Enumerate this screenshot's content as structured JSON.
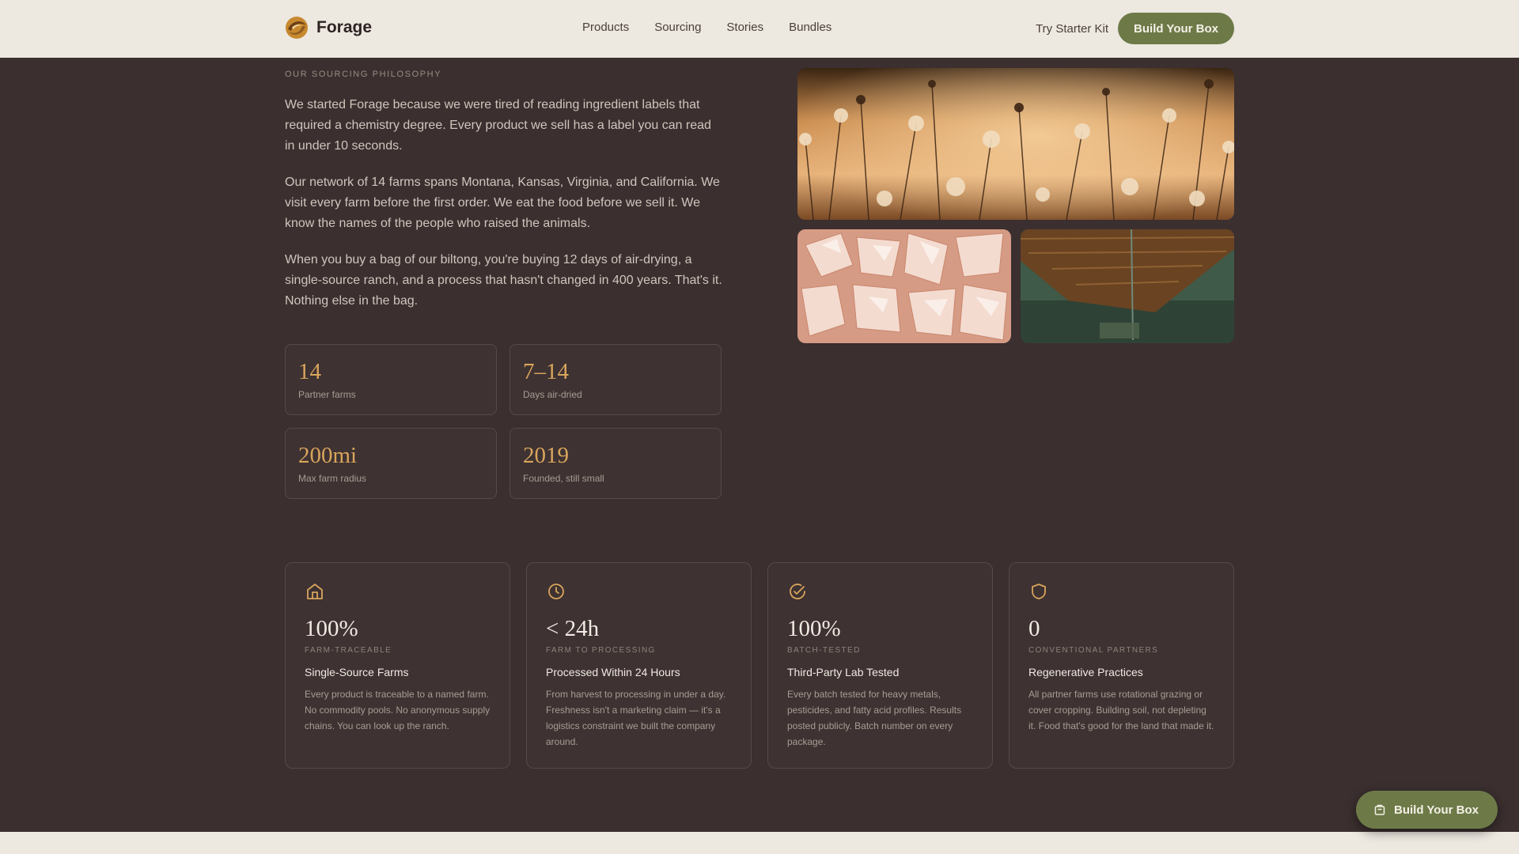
{
  "header": {
    "brand": "Forage",
    "nav": [
      "Products",
      "Sourcing",
      "Stories",
      "Bundles"
    ],
    "starter_link": "Try Starter Kit",
    "cta": "Build Your Box"
  },
  "philosophy": {
    "eyebrow": "OUR SOURCING PHILOSOPHY",
    "paragraphs": [
      "We started Forage because we were tired of reading ingredient labels that required a chemistry degree. Every product we sell has a label you can read in under 10 seconds.",
      "Our network of 14 farms spans Montana, Kansas, Virginia, and California. We visit every farm before the first order. We eat the food before we sell it. We know the names of the people who raised the animals.",
      "When you buy a bag of our biltong, you're buying 12 days of air-drying, a single-source ranch, and a process that hasn't changed in 400 years. That's it. Nothing else in the bag."
    ],
    "stats": [
      {
        "value": "14",
        "label": "Partner farms"
      },
      {
        "value": "7–14",
        "label": "Days air-dried"
      },
      {
        "value": "200mi",
        "label": "Max farm radius"
      },
      {
        "value": "2019",
        "label": "Founded, still small"
      }
    ]
  },
  "images": [
    {
      "icon": "wildflowers-photo"
    },
    {
      "icon": "salt-crystals-photo"
    },
    {
      "icon": "barn-photo"
    }
  ],
  "features": [
    {
      "icon": "home-icon",
      "value": "100%",
      "kicker": "FARM-TRACEABLE",
      "title": "Single-Source Farms",
      "desc": "Every product is traceable to a named farm. No commodity pools. No anonymous supply chains. You can look up the ranch."
    },
    {
      "icon": "clock-icon",
      "value": "< 24h",
      "kicker": "FARM TO PROCESSING",
      "title": "Processed Within 24 Hours",
      "desc": "From harvest to processing in under a day. Freshness isn't a marketing claim — it's a logistics constraint we built the company around."
    },
    {
      "icon": "check-circle-icon",
      "value": "100%",
      "kicker": "BATCH-TESTED",
      "title": "Third-Party Lab Tested",
      "desc": "Every batch tested for heavy metals, pesticides, and fatty acid profiles. Results posted publicly. Batch number on every package."
    },
    {
      "icon": "shield-icon",
      "value": "0",
      "kicker": "CONVENTIONAL PARTNERS",
      "title": "Regenerative Practices",
      "desc": "All partner farms use rotational grazing or cover cropping. Building soil, not depleting it. Food that's good for the land that made it."
    }
  ],
  "floating_cta": {
    "label": "Build Your Box",
    "icon": "box-icon"
  },
  "colors": {
    "background": "#3b2f2f",
    "header": "#ede8e0",
    "accent_green": "#6d7a48",
    "stat_gold": "#d9a55c"
  }
}
